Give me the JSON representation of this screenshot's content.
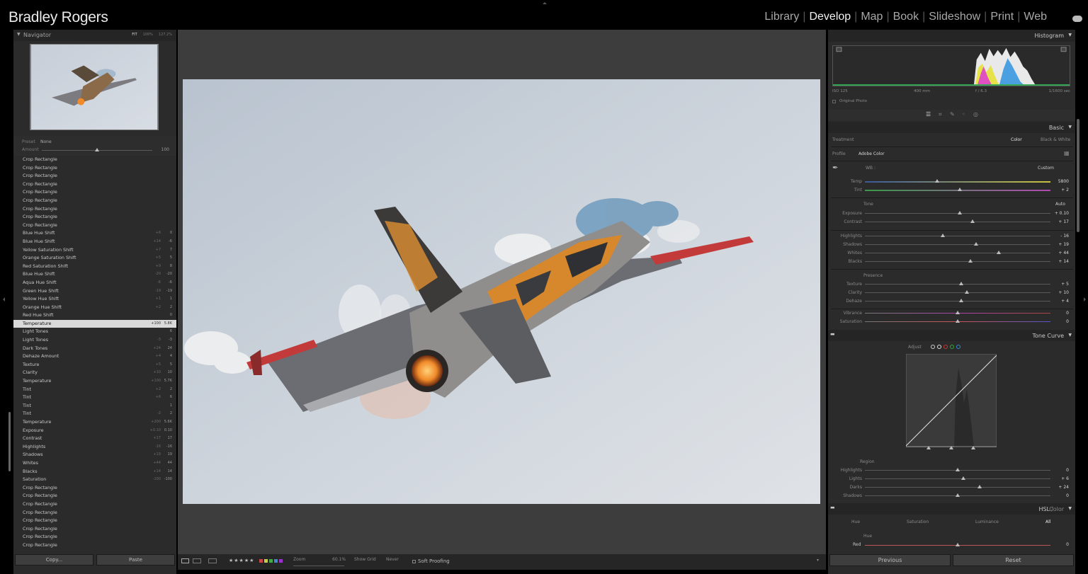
{
  "identity_plate": "Bradley Rogers",
  "modules": [
    "Library",
    "Develop",
    "Map",
    "Book",
    "Slideshow",
    "Print",
    "Web"
  ],
  "active_module": "Develop",
  "navigator": {
    "title": "Navigator",
    "fit": "FIT",
    "zoom1": "100%",
    "zoom2": "127.2%"
  },
  "preset": {
    "label": "Preset",
    "value": "None",
    "amount_label": "Amount",
    "amount_value": "100",
    "amount_level": 0.5
  },
  "history": [
    {
      "name": "Crop Rectangle",
      "from": "",
      "to": ""
    },
    {
      "name": "Crop Rectangle",
      "from": "",
      "to": ""
    },
    {
      "name": "Crop Rectangle",
      "from": "",
      "to": ""
    },
    {
      "name": "Crop Rectangle",
      "from": "",
      "to": ""
    },
    {
      "name": "Crop Rectangle",
      "from": "",
      "to": ""
    },
    {
      "name": "Crop Rectangle",
      "from": "",
      "to": ""
    },
    {
      "name": "Crop Rectangle",
      "from": "",
      "to": ""
    },
    {
      "name": "Crop Rectangle",
      "from": "",
      "to": ""
    },
    {
      "name": "Crop Rectangle",
      "from": "",
      "to": ""
    },
    {
      "name": "Blue Hue Shift",
      "from": "+6",
      "to": "0"
    },
    {
      "name": "Blue Hue Shift",
      "from": "+14",
      "to": "-6"
    },
    {
      "name": "Yellow Saturation Shift",
      "from": "+7",
      "to": "7"
    },
    {
      "name": "Orange Saturation Shift",
      "from": "+5",
      "to": "5"
    },
    {
      "name": "Red Saturation Shift",
      "from": "+9",
      "to": "8"
    },
    {
      "name": "Blue Hue Shift",
      "from": "-20",
      "to": "-20"
    },
    {
      "name": "Aqua Hue Shift",
      "from": "-6",
      "to": "-6"
    },
    {
      "name": "Green Hue Shift",
      "from": "-19",
      "to": "-19"
    },
    {
      "name": "Yellow Hue Shift",
      "from": "+1",
      "to": "1"
    },
    {
      "name": "Orange Hue Shift",
      "from": "+2",
      "to": "2"
    },
    {
      "name": "Red Hue Shift",
      "from": "",
      "to": "0"
    },
    {
      "name": "Temperature",
      "from": "+100",
      "to": "5.8K",
      "selected": true
    },
    {
      "name": "Light Tones",
      "from": "",
      "to": "6"
    },
    {
      "name": "Light Tones",
      "from": "-3",
      "to": "-3"
    },
    {
      "name": "Dark Tones",
      "from": "+24",
      "to": "24"
    },
    {
      "name": "Dehaze Amount",
      "from": "+4",
      "to": "4"
    },
    {
      "name": "Texture",
      "from": "+5",
      "to": "5"
    },
    {
      "name": "Clarity",
      "from": "+10",
      "to": "10"
    },
    {
      "name": "Temperature",
      "from": "+100",
      "to": "5.7K"
    },
    {
      "name": "Tint",
      "from": "+2",
      "to": "2"
    },
    {
      "name": "Tint",
      "from": "+6",
      "to": "6"
    },
    {
      "name": "Tint",
      "from": "",
      "to": "1"
    },
    {
      "name": "Tint",
      "from": "-2",
      "to": "2"
    },
    {
      "name": "Temperature",
      "from": "+200",
      "to": "5.6K"
    },
    {
      "name": "Exposure",
      "from": "+0.10",
      "to": "0.10"
    },
    {
      "name": "Contrast",
      "from": "+17",
      "to": "17"
    },
    {
      "name": "Highlights",
      "from": "-16",
      "to": "-16"
    },
    {
      "name": "Shadows",
      "from": "+19",
      "to": "19"
    },
    {
      "name": "Whites",
      "from": "+44",
      "to": "44"
    },
    {
      "name": "Blacks",
      "from": "+14",
      "to": "14"
    },
    {
      "name": "Saturation",
      "from": "-100",
      "to": "-100"
    },
    {
      "name": "Crop Rectangle",
      "from": "",
      "to": ""
    },
    {
      "name": "Crop Rectangle",
      "from": "",
      "to": ""
    },
    {
      "name": "Crop Rectangle",
      "from": "",
      "to": ""
    },
    {
      "name": "Crop Rectangle",
      "from": "",
      "to": ""
    },
    {
      "name": "Crop Rectangle",
      "from": "",
      "to": ""
    },
    {
      "name": "Crop Rectangle",
      "from": "",
      "to": ""
    },
    {
      "name": "Crop Rectangle",
      "from": "",
      "to": ""
    },
    {
      "name": "Crop Rectangle",
      "from": "",
      "to": ""
    }
  ],
  "left_buttons": {
    "copy": "Copy...",
    "paste": "Paste"
  },
  "toolbar": {
    "stars": "★★★★★",
    "zoom_label": "Zoom",
    "zoom_value": "60.1%",
    "grid_label": "Show Grid",
    "grid_value": "Never",
    "soft_proofing": "Soft Proofing"
  },
  "histogram": {
    "title": "Histogram",
    "iso": "ISO 125",
    "focal": "400 mm",
    "aperture": "f / 6.3",
    "shutter": "1/1600 sec",
    "original": "Original Photo"
  },
  "basic": {
    "title": "Basic",
    "treatment_label": "Treatment",
    "treatment_color": "Color",
    "treatment_bw": "Black & White",
    "profile_label": "Profile",
    "profile_value": "Adobe Color",
    "wb_label": "WB :",
    "wb_value": "Custom",
    "temp_label": "Temp",
    "temp_value": "5800",
    "temp_level": 0.39,
    "tint_label": "Tint",
    "tint_value": "+ 2",
    "tint_level": 0.51,
    "tone_label": "Tone",
    "auto_label": "Auto",
    "tone_sliders": [
      {
        "label": "Exposure",
        "value": "+ 0.10",
        "level": 0.51
      },
      {
        "label": "Contrast",
        "value": "+ 17",
        "level": 0.58
      },
      {
        "label": "Highlights",
        "value": "- 16",
        "level": 0.42
      },
      {
        "label": "Shadows",
        "value": "+ 19",
        "level": 0.6
      },
      {
        "label": "Whites",
        "value": "+ 44",
        "level": 0.72
      },
      {
        "label": "Blacks",
        "value": "+ 14",
        "level": 0.57
      }
    ],
    "presence_label": "Presence",
    "presence_sliders": [
      {
        "label": "Texture",
        "value": "+ 5",
        "level": 0.52
      },
      {
        "label": "Clarity",
        "value": "+ 10",
        "level": 0.55
      },
      {
        "label": "Dehaze",
        "value": "+ 4",
        "level": 0.52
      },
      {
        "label": "Vibrance",
        "value": "0",
        "level": 0.5
      },
      {
        "label": "Saturation",
        "value": "0",
        "level": 0.5
      }
    ]
  },
  "tone_curve": {
    "title": "Tone Curve",
    "adjust_label": "Adjust",
    "region_label": "Region",
    "regions": [
      {
        "label": "Highlights",
        "value": "0",
        "level": 0.5
      },
      {
        "label": "Lights",
        "value": "+ 6",
        "level": 0.53
      },
      {
        "label": "Darks",
        "value": "+ 24",
        "level": 0.62
      },
      {
        "label": "Shadows",
        "value": "0",
        "level": 0.5
      }
    ]
  },
  "hsl": {
    "title_hsl": "HSL",
    "title_color": "Color",
    "tabs": [
      "Hue",
      "Saturation",
      "Luminance",
      "All"
    ],
    "active_tab": "All",
    "hue_label": "Hue",
    "red_label": "Red",
    "red_value": "0",
    "red_level": 0.5
  },
  "right_buttons": {
    "previous": "Previous",
    "reset": "Reset"
  },
  "colors": {
    "bg": "#000000",
    "panel": "#2b2b2b",
    "center": "#3d3d3d",
    "sky": "#cfd6df",
    "flame": "#f08a2a"
  }
}
